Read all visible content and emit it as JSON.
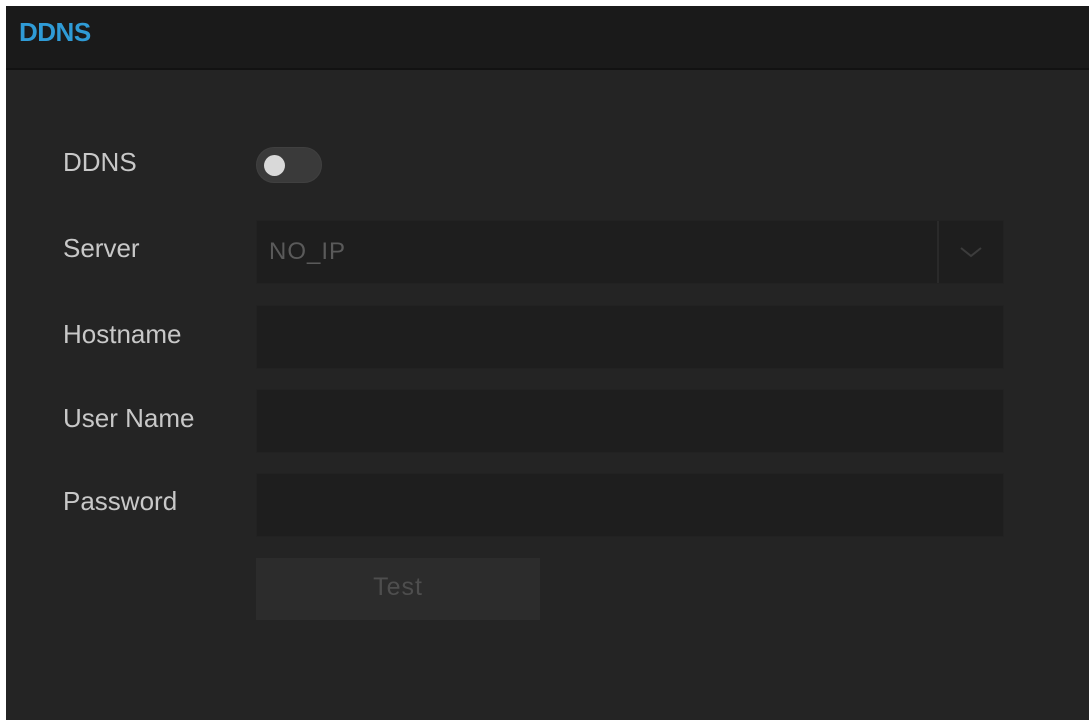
{
  "header": {
    "title": "DDNS"
  },
  "form": {
    "ddns": {
      "label": "DDNS",
      "enabled": false
    },
    "server": {
      "label": "Server",
      "value": "NO_IP"
    },
    "hostname": {
      "label": "Hostname",
      "value": ""
    },
    "username": {
      "label": "User Name",
      "value": ""
    },
    "password": {
      "label": "Password",
      "value": ""
    },
    "test_label": "Test"
  },
  "colors": {
    "accent": "#2f9bd6",
    "background": "#242424",
    "field": "#1e1e1e"
  },
  "icons": {
    "select_arrow": "chevron-down-icon"
  }
}
